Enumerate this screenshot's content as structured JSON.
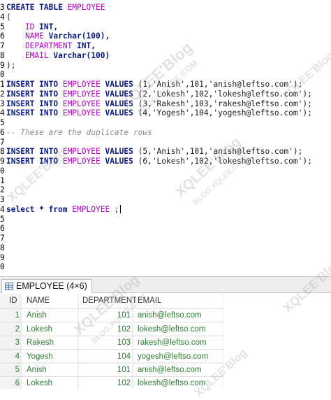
{
  "editor": {
    "lines": [
      {
        "n": "3",
        "parts": [
          {
            "t": "CREATE TABLE ",
            "c": "kw"
          },
          {
            "t": "EMPLOYEE",
            "c": "tbl"
          }
        ]
      },
      {
        "n": "4",
        "parts": [
          {
            "t": "(",
            "c": ""
          }
        ]
      },
      {
        "n": "5",
        "parts": [
          {
            "t": "    ID ",
            "c": "tbl"
          },
          {
            "t": "INT,",
            "c": "kw"
          }
        ]
      },
      {
        "n": "6",
        "parts": [
          {
            "t": "    NAME ",
            "c": "tbl"
          },
          {
            "t": "Varchar(100),",
            "c": "kw"
          }
        ]
      },
      {
        "n": "7",
        "parts": [
          {
            "t": "    DEPARTMENT ",
            "c": "tbl"
          },
          {
            "t": "INT,",
            "c": "kw"
          }
        ]
      },
      {
        "n": "8",
        "parts": [
          {
            "t": "    EMAIL ",
            "c": "tbl"
          },
          {
            "t": "Varchar(100)",
            "c": "kw"
          }
        ]
      },
      {
        "n": "9",
        "parts": [
          {
            "t": ");",
            "c": ""
          }
        ]
      },
      {
        "n": "0",
        "parts": []
      },
      {
        "n": "1",
        "parts": [
          {
            "t": "INSERT INTO ",
            "c": "kw"
          },
          {
            "t": "EMPLOYEE",
            "c": "tbl"
          },
          {
            "t": " VALUES ",
            "c": "kw"
          },
          {
            "t": "(1,'Anish',101,'anish@leftso.com');",
            "c": "str"
          }
        ]
      },
      {
        "n": "2",
        "parts": [
          {
            "t": "INSERT INTO ",
            "c": "kw"
          },
          {
            "t": "EMPLOYEE",
            "c": "tbl"
          },
          {
            "t": " VALUES ",
            "c": "kw"
          },
          {
            "t": "(2,'Lokesh',102,'lokesh@leftso.com');",
            "c": "str"
          }
        ]
      },
      {
        "n": "3",
        "parts": [
          {
            "t": "INSERT INTO ",
            "c": "kw"
          },
          {
            "t": "EMPLOYEE",
            "c": "tbl"
          },
          {
            "t": " VALUES ",
            "c": "kw"
          },
          {
            "t": "(3,'Rakesh',103,'rakesh@leftso.com');",
            "c": "str"
          }
        ]
      },
      {
        "n": "4",
        "parts": [
          {
            "t": "INSERT INTO ",
            "c": "kw"
          },
          {
            "t": "EMPLOYEE",
            "c": "tbl"
          },
          {
            "t": " VALUES ",
            "c": "kw"
          },
          {
            "t": "(4,'Yogesh',104,'yogesh@leftso.com');",
            "c": "str"
          }
        ]
      },
      {
        "n": "5",
        "parts": []
      },
      {
        "n": "6",
        "parts": [
          {
            "t": "-- These are the duplicate rows",
            "c": "cmt"
          }
        ]
      },
      {
        "n": "7",
        "parts": []
      },
      {
        "n": "8",
        "parts": [
          {
            "t": "INSERT INTO ",
            "c": "kw"
          },
          {
            "t": "EMPLOYEE",
            "c": "tbl"
          },
          {
            "t": " VALUES ",
            "c": "kw"
          },
          {
            "t": "(5,'Anish',101,'anish@leftso.com');",
            "c": "str"
          }
        ]
      },
      {
        "n": "9",
        "parts": [
          {
            "t": "INSERT INTO ",
            "c": "kw"
          },
          {
            "t": "EMPLOYEE",
            "c": "tbl"
          },
          {
            "t": " VALUES ",
            "c": "kw"
          },
          {
            "t": "(6,'Lokesh',102,'lokesh@leftso.com');",
            "c": "str"
          }
        ]
      },
      {
        "n": "0",
        "parts": []
      },
      {
        "n": "1",
        "parts": []
      },
      {
        "n": "2",
        "parts": []
      },
      {
        "n": "3",
        "parts": []
      },
      {
        "n": "4",
        "parts": [
          {
            "t": "select * from ",
            "c": "kw"
          },
          {
            "t": "EMPLOYEE",
            "c": "tbl"
          },
          {
            "t": " ;",
            "c": ""
          }
        ],
        "caret": true
      },
      {
        "n": "5",
        "parts": []
      },
      {
        "n": "6",
        "parts": []
      },
      {
        "n": "7",
        "parts": []
      },
      {
        "n": "8",
        "parts": []
      },
      {
        "n": "9",
        "parts": []
      },
      {
        "n": "0",
        "parts": []
      }
    ]
  },
  "results": {
    "tab_label": "EMPLOYEE (4×6)",
    "columns": [
      "ID",
      "NAME",
      "DEPARTMENT",
      "EMAIL"
    ],
    "rows": [
      [
        "1",
        "Anish",
        "101",
        "anish@leftso.com"
      ],
      [
        "2",
        "Lokesh",
        "102",
        "lokesh@leftso.com"
      ],
      [
        "3",
        "Rakesh",
        "103",
        "rakesh@leftso.com"
      ],
      [
        "4",
        "Yogesh",
        "104",
        "yogesh@leftso.com"
      ],
      [
        "5",
        "Anish",
        "101",
        "anish@leftso.com"
      ],
      [
        "6",
        "Lokesh",
        "102",
        "lokesh@leftso.com"
      ]
    ]
  },
  "watermark": {
    "brand": "XQLEE'Blog",
    "domain": "BLOG.XQLEE.COM"
  },
  "colors": {
    "keyword": "#0a1a80",
    "identifier": "#b000c0",
    "comment": "#8a8a8a",
    "cell_value": "#2e7d32"
  }
}
